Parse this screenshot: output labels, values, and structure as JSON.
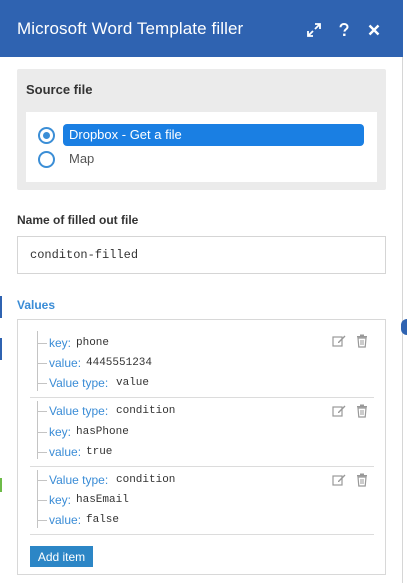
{
  "dialog": {
    "title": "Microsoft Word Template filler",
    "icons": [
      "expand-icon",
      "help-icon",
      "close-icon"
    ]
  },
  "source": {
    "label": "Source file",
    "options": [
      {
        "label": "Dropbox - Get a file",
        "selected": true
      },
      {
        "label": "Map",
        "selected": false
      }
    ]
  },
  "filled_file": {
    "label": "Name of filled out file",
    "value": "conditon-filled"
  },
  "values": {
    "label": "Values",
    "items": [
      {
        "rows": [
          {
            "key": "key:",
            "value": "phone"
          },
          {
            "key": "value:",
            "value": "4445551234"
          },
          {
            "key": "Value type:",
            "value": "value"
          }
        ]
      },
      {
        "rows": [
          {
            "key": "Value type:",
            "value": "condition"
          },
          {
            "key": "key:",
            "value": "hasPhone"
          },
          {
            "key": "value:",
            "value": "true"
          }
        ]
      },
      {
        "rows": [
          {
            "key": "Value type:",
            "value": "condition"
          },
          {
            "key": "key:",
            "value": "hasEmail"
          },
          {
            "key": "value:",
            "value": "false"
          }
        ]
      }
    ],
    "add_label": "Add item"
  },
  "colors": {
    "header": "#2f63b1",
    "accent": "#3a8cd6",
    "selected_option": "#1a7fe3",
    "button": "#2c86c6"
  }
}
